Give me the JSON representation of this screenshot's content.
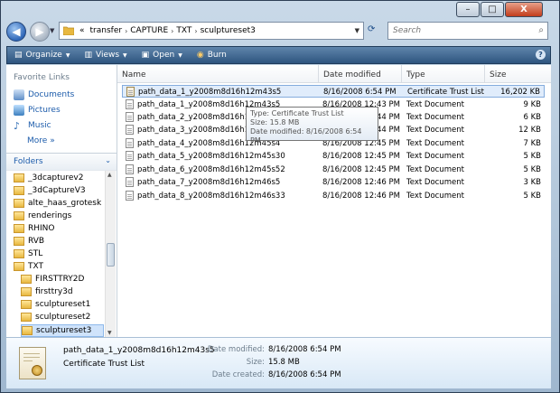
{
  "window": {
    "caption_buttons": [
      "–",
      "□",
      "X"
    ]
  },
  "address_bar": {
    "prefix": "«",
    "crumbs": [
      "transfer",
      "CAPTURE",
      "TXT",
      "sculptureset3"
    ],
    "separator": "›"
  },
  "search": {
    "placeholder": "Search"
  },
  "toolbar": {
    "organize": "Organize",
    "views": "Views",
    "open": "Open",
    "burn": "Burn",
    "help": "?"
  },
  "nav_pane": {
    "favorites_heading": "Favorite Links",
    "favorites": [
      {
        "label": "Documents",
        "icon": "documents-icon"
      },
      {
        "label": "Pictures",
        "icon": "pictures-icon"
      },
      {
        "label": "Music",
        "icon": "music-icon"
      }
    ],
    "more_label": "More",
    "folders_heading": "Folders",
    "folders": [
      {
        "label": "_3dcapturev2",
        "level": 1
      },
      {
        "label": "_3dCaptureV3",
        "level": 1
      },
      {
        "label": "alte_haas_grotesk",
        "level": 1
      },
      {
        "label": "renderings",
        "level": 1
      },
      {
        "label": "RHINO",
        "level": 1
      },
      {
        "label": "RVB",
        "level": 1
      },
      {
        "label": "STL",
        "level": 1
      },
      {
        "label": "TXT",
        "level": 1
      },
      {
        "label": "FIRSTTRY2D",
        "level": 2
      },
      {
        "label": "firsttry3d",
        "level": 2
      },
      {
        "label": "sculptureset1",
        "level": 2
      },
      {
        "label": "sculptureset2",
        "level": 2
      },
      {
        "label": "sculptureset3",
        "level": 2,
        "selected": true
      }
    ]
  },
  "file_list": {
    "columns": [
      "Name",
      "Date modified",
      "Type",
      "Size"
    ],
    "rows": [
      {
        "name": "path_data_1_y2008m8d16h12m43s5",
        "date": "8/16/2008 6:54 PM",
        "type": "Certificate Trust List",
        "size": "16,202 KB",
        "selected": true,
        "cert": true
      },
      {
        "name": "path_data_1_y2008m8d16h12m43s5",
        "date": "8/16/2008 12:43 PM",
        "type": "Text Document",
        "size": "9 KB"
      },
      {
        "name": "path_data_2_y2008m8d16h12m44s",
        "date": "8/16/2008 12:44 PM",
        "type": "Text Document",
        "size": "6 KB"
      },
      {
        "name": "path_data_3_y2008m8d16h12m44s",
        "date": "8/16/2008 12:44 PM",
        "type": "Text Document",
        "size": "12 KB"
      },
      {
        "name": "path_data_4_y2008m8d16h12m45s4",
        "date": "8/16/2008 12:45 PM",
        "type": "Text Document",
        "size": "7 KB"
      },
      {
        "name": "path_data_5_y2008m8d16h12m45s30",
        "date": "8/16/2008 12:45 PM",
        "type": "Text Document",
        "size": "5 KB"
      },
      {
        "name": "path_data_6_y2008m8d16h12m45s52",
        "date": "8/16/2008 12:45 PM",
        "type": "Text Document",
        "size": "5 KB"
      },
      {
        "name": "path_data_7_y2008m8d16h12m46s5",
        "date": "8/16/2008 12:46 PM",
        "type": "Text Document",
        "size": "3 KB"
      },
      {
        "name": "path_data_8_y2008m8d16h12m46s33",
        "date": "8/16/2008 12:46 PM",
        "type": "Text Document",
        "size": "5 KB"
      }
    ]
  },
  "tooltip": {
    "type_line": "Type: Certificate Trust List",
    "size_line": "Size: 15.8 MB",
    "date_line": "Date modified: 8/16/2008 6:54 PM"
  },
  "details_pane": {
    "name": "path_data_1_y2008m8d16h12m43s5",
    "type": "Certificate Trust List",
    "date_modified_label": "Date modified:",
    "date_modified": "8/16/2008 6:54 PM",
    "size_label": "Size:",
    "size": "15.8 MB",
    "date_created_label": "Date created:",
    "date_created": "8/16/2008 6:54 PM"
  }
}
